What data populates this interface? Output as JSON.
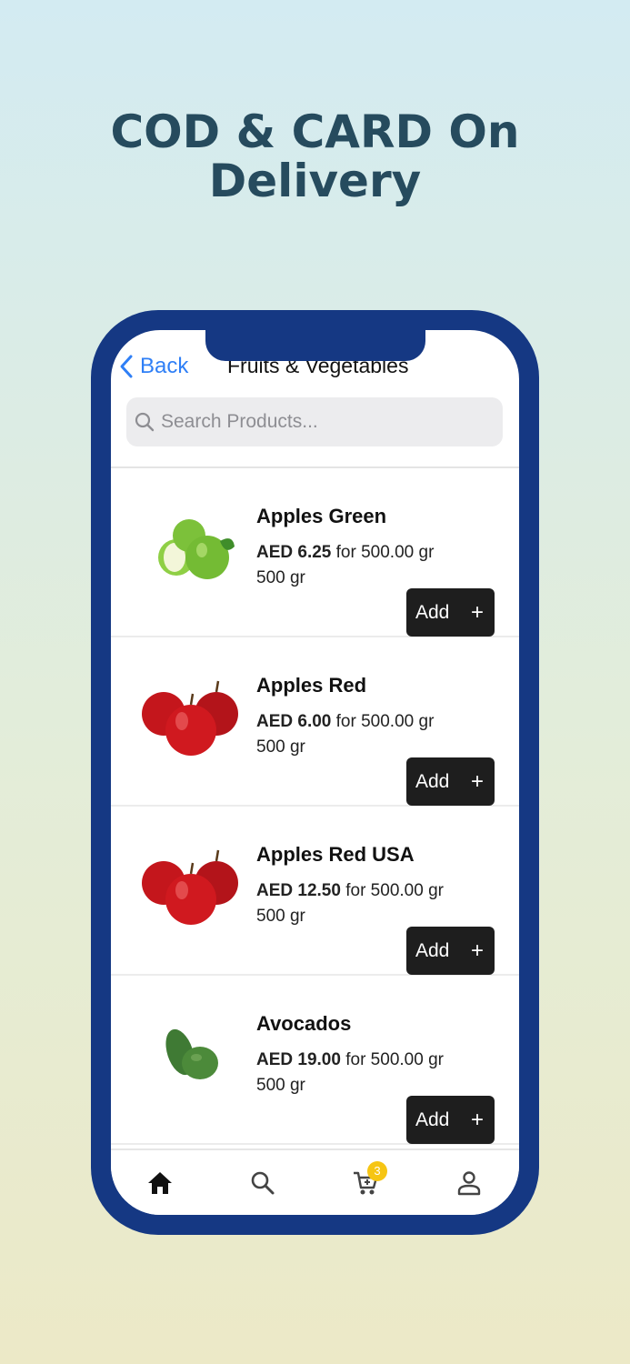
{
  "headline": {
    "line1": "COD & CARD On",
    "line2": "Delivery"
  },
  "phone_colors": {
    "frame": "#153883",
    "accent": "#2f7ff6",
    "badge": "#f6c514"
  },
  "nav": {
    "back_label": "Back",
    "title": "Fruits & Vegetables"
  },
  "search": {
    "placeholder": "Search Products..."
  },
  "products": [
    {
      "name": "Apples Green",
      "price": "AED 6.25",
      "per": " for 500.00 gr",
      "unit": "500 gr",
      "add_label": "Add",
      "add_icon": "+"
    },
    {
      "name": "Apples Red",
      "price": "AED 6.00",
      "per": " for 500.00 gr",
      "unit": "500 gr",
      "add_label": "Add",
      "add_icon": "+"
    },
    {
      "name": "Apples Red USA",
      "price": "AED 12.50",
      "per": " for 500.00 gr",
      "unit": "500 gr",
      "add_label": "Add",
      "add_icon": "+"
    },
    {
      "name": "Avocados",
      "price": "AED 19.00",
      "per": " for 500.00 gr",
      "unit": "500 gr",
      "add_label": "Add",
      "add_icon": "+"
    }
  ],
  "tabbar": {
    "icons": [
      "home-icon",
      "search-icon",
      "cart-icon",
      "profile-icon"
    ],
    "cart_badge": "3"
  }
}
